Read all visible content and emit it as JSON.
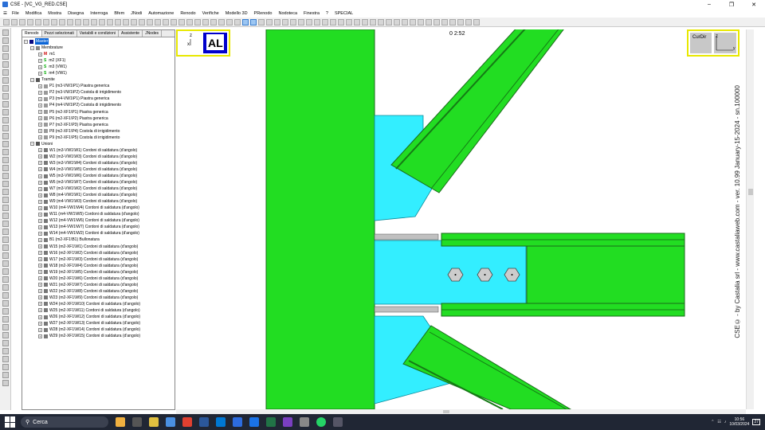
{
  "window": {
    "title": "CSE - [VC_VG_RED.CSE]"
  },
  "menu": [
    "File",
    "Modifica",
    "Mostra",
    "Disegna",
    "Interroga",
    "Bfem",
    "JNodi",
    "Automazione",
    "Renodo",
    "Verifiche",
    "Modello 3D",
    "PRenodo",
    "Nodoteca",
    "Finestra",
    "?",
    "SPECIAL"
  ],
  "tabs": [
    "Renodo",
    "Pezzi selezionati",
    "Variabili e condizioni",
    "Assistente",
    "JNodes"
  ],
  "tree": {
    "root": "Master",
    "membrature_label": "Membrature",
    "membrature": [
      {
        "tag": "M",
        "text": "m1"
      },
      {
        "tag": "S",
        "text": "m2 (XF1)"
      },
      {
        "tag": "S",
        "text": "m3 (VW1)"
      },
      {
        "tag": "S",
        "text": "m4 (VW1)"
      }
    ],
    "tramite_label": "Tramite",
    "tramite": [
      "P1 (m3-VW1\\P1)  Piastra generica",
      "P2 (m3-VW1\\P2)  Costola di irrigidimento",
      "P3 (m4-VW1\\P1)  Piastra generica",
      "P4 (m4-VW1\\P2)  Costola di irrigidimento",
      "P5 (m2-XF1\\P1)  Piastra generica",
      "P6 (m2-XF1\\P2)  Piastra generica",
      "P7 (m2-XF1\\P3)  Piastra generica",
      "P8 (m2-XF1\\P4)  Costola di irrigidimento",
      "P9 (m2-XF1\\P5)  Costola di irrigidimento"
    ],
    "unioni_label": "Unioni",
    "unioni": [
      "W1 (m3-VW1\\W1)  Cordoni di saldatura (d'angolo)",
      "W2 (m3-VW1\\W3)  Cordoni di saldatura (d'angolo)",
      "W3 (m3-VW1\\W4)  Cordoni di saldatura (d'angolo)",
      "W4 (m3-VW1\\W5)  Cordoni di saldatura (d'angolo)",
      "W5 (m3-VW1\\W6)  Cordoni di saldatura (d'angolo)",
      "W6 (m3-VW1\\W7)  Cordoni di saldatura (d'angolo)",
      "W7 (m3-VW1\\W2)  Cordoni di saldatura (d'angolo)",
      "W8 (m4-VW1\\W1)  Cordoni di saldatura (d'angolo)",
      "W9 (m4-VW1\\W3)  Cordoni di saldatura (d'angolo)",
      "W10 (m4-VW1\\W4)  Cordoni di saldatura (d'angolo)",
      "W11 (m4-VW1\\W5)  Cordoni di saldatura (d'angolo)",
      "W12 (m4-VW1\\W6)  Cordoni di saldatura (d'angolo)",
      "W13 (m4-VW1\\W7)  Cordoni di saldatura (d'angolo)",
      "W14 (m4-VW1\\W2)  Cordoni di saldatura (d'angolo)",
      "B1 (m2-XF1\\B1)  Bullonatura",
      "W15 (m2-XF1\\W1)  Cordoni di saldatura (d'angolo)",
      "W16 (m2-XF1\\W2)  Cordoni di saldatura (d'angolo)",
      "W17 (m2-XF1\\W3)  Cordoni di saldatura (d'angolo)",
      "W18 (m2-XF1\\W4)  Cordoni di saldatura (d'angolo)",
      "W19 (m2-XF1\\W5)  Cordoni di saldatura (d'angolo)",
      "W20 (m2-XF1\\W6)  Cordoni di saldatura (d'angolo)",
      "W21 (m2-XF1\\W7)  Cordoni di saldatura (d'angolo)",
      "W22 (m2-XF1\\W8)  Cordoni di saldatura (d'angolo)",
      "W23 (m2-XF1\\W9)  Cordoni di saldatura (d'angolo)",
      "W24 (m2-XF1\\W10)  Cordoni di saldatura (d'angolo)",
      "W25 (m2-XF1\\W11)  Cordoni di saldatura (d'angolo)",
      "W26 (m2-XF1\\W12)  Cordoni di saldatura (d'angolo)",
      "W27 (m2-XF1\\W13)  Cordoni di saldatura (d'angolo)",
      "W28 (m2-XF1\\W14)  Cordoni di saldatura (d'angolo)",
      "W29 (m2-XF1\\W15)  Cordoni di saldatura (d'angolo)"
    ]
  },
  "viewport": {
    "axis_badge": "AL",
    "counter": "0  2:52",
    "cube_label": "CurDir",
    "vertical_text": "CSE© - by Castalia srl - www.castaliaweb.com - ver. 10.99 January-15-2024 - sn.100000"
  },
  "taskbar": {
    "search_placeholder": "Cerca",
    "time": "10:56",
    "date": "10/03/2024",
    "badge": "27"
  },
  "colors": {
    "steel_green": "#22dd22",
    "plate_cyan": "#33eeff",
    "bolt": "#cccccc"
  }
}
